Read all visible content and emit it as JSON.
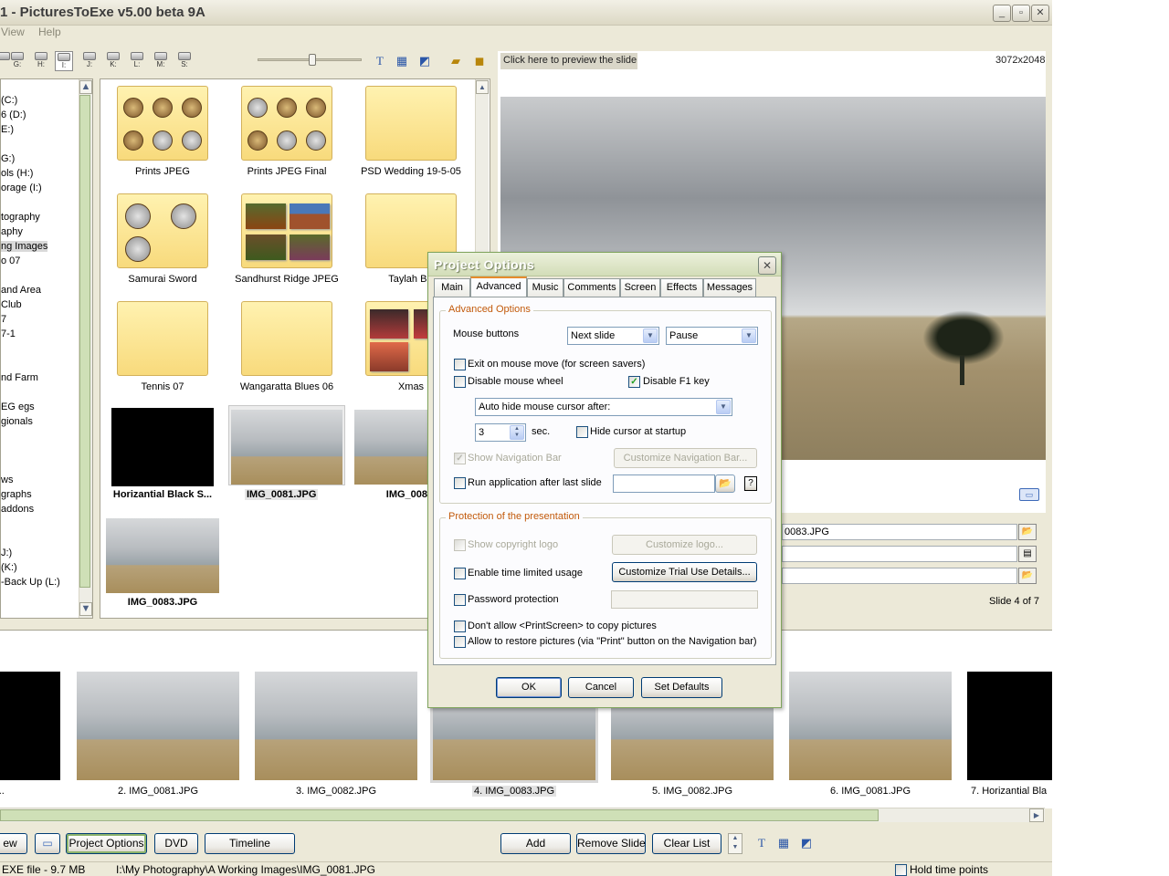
{
  "window": {
    "title": "1 - PicturesToExe v5.00 beta 9A"
  },
  "menu": [
    "View",
    "Help"
  ],
  "toolbar": {
    "drive_letters": [
      "",
      "G:",
      "H:",
      "I:",
      "J:",
      "K:",
      "L:",
      "M:",
      "S:"
    ],
    "selected_drive": "I:"
  },
  "tree": {
    "items": [
      "(C:)",
      "6 (D:)",
      "E:)",
      "G:)",
      "ols (H:)",
      "orage (I:)",
      "tography",
      "aphy",
      "ng Images",
      "o 07",
      "and Area",
      "Club",
      "7",
      "7-1",
      "nd Farm",
      "EG egs",
      "gionals",
      "ws",
      "graphs",
      "addons",
      "J:)",
      "(K:)",
      "-Back Up (L:)"
    ],
    "selected": "ng Images"
  },
  "grid": {
    "items": [
      "Prints JPEG",
      "Prints JPEG Final",
      "PSD Wedding 19-5-05",
      "Samurai Sword",
      "Sandhurst Ridge JPEG",
      "Taylah BB",
      "Tennis 07",
      "Wangaratta Blues 06",
      "Xmas",
      "Horizantial Black S...",
      "IMG_0081.JPG",
      "IMG_0082.",
      "IMG_0083.JPG"
    ]
  },
  "preview": {
    "header": "Click here to preview the slide",
    "resolution": "3072x2048"
  },
  "slide_props": {
    "file": "0083.JPG",
    "slide_count": "Slide 4 of 7"
  },
  "strip": {
    "captions": [
      "de for Intr...",
      "2. IMG_0081.JPG",
      "3. IMG_0082.JPG",
      "4. IMG_0083.JPG",
      "5. IMG_0082.JPG",
      "6. IMG_0081.JPG",
      "7. Horizantial Bla"
    ],
    "selected": "4. IMG_0083.JPG"
  },
  "bottom": {
    "buttons": [
      "ew",
      "Project Options",
      "DVD",
      "Timeline",
      "Add",
      "Remove Slide",
      "Clear List"
    ]
  },
  "status": {
    "size": "EXE file - 9.7 MB",
    "path": "I:\\My Photography\\A Working Images\\IMG_0081.JPG",
    "hold": "Hold time points"
  },
  "dialog": {
    "title": "Project Options",
    "tabs": [
      "Main",
      "Advanced",
      "Music",
      "Comments",
      "Screen",
      "Effects",
      "Messages"
    ],
    "active_tab": "Advanced",
    "adv_group": "Advanced Options",
    "mouse_buttons_label": "Mouse buttons",
    "mouse_left": "Next slide",
    "mouse_right": "Pause",
    "exit_mouse": "Exit on mouse move (for screen savers)",
    "disable_wheel": "Disable mouse wheel",
    "disable_f1": "Disable F1 key",
    "auto_hide": "Auto hide mouse cursor after:",
    "sec_value": "3",
    "sec_label": "sec.",
    "hide_startup": "Hide cursor at startup",
    "show_nav": "Show Navigation Bar",
    "customize_nav": "Customize Navigation Bar...",
    "run_app": "Run application after last slide",
    "prot_group": "Protection of the presentation",
    "copyright": "Show copyright logo",
    "customize_logo": "Customize logo...",
    "time_limited": "Enable time limited usage",
    "customize_trial": "Customize Trial Use Details...",
    "password": "Password protection",
    "printscreen": "Don't allow <PrintScreen> to copy pictures",
    "restore": "Allow to restore pictures (via \"Print\" button on the Navigation bar)",
    "ok": "OK",
    "cancel": "Cancel",
    "defaults": "Set Defaults"
  }
}
